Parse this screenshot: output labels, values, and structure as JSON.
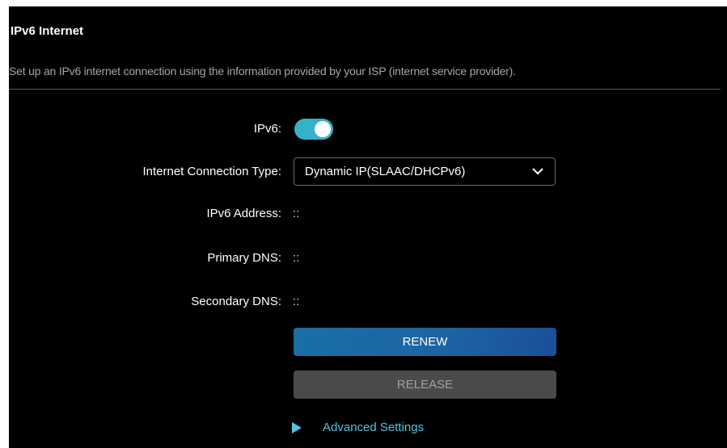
{
  "section": {
    "title": "IPv6 Internet",
    "description": "Set up an IPv6 internet connection using the information provided by your ISP (internet service provider)."
  },
  "fields": {
    "ipv6_label": "IPv6:",
    "ipv6_enabled": true,
    "connection_type_label": "Internet Connection Type:",
    "connection_type_value": "Dynamic IP(SLAAC/DHCPv6)",
    "ipv6_address_label": "IPv6 Address:",
    "ipv6_address_value": "::",
    "primary_dns_label": "Primary DNS:",
    "primary_dns_value": "::",
    "secondary_dns_label": "Secondary DNS:",
    "secondary_dns_value": "::"
  },
  "buttons": {
    "renew": "RENEW",
    "release": "RELEASE"
  },
  "advanced": {
    "label": "Advanced Settings"
  },
  "icons": {
    "toggle": "toggle-switch-on",
    "dropdown": "chevron-down-icon",
    "expand": "triangle-right-icon"
  },
  "colors": {
    "background": "#000000",
    "accent": "#37b1c9",
    "link": "#4fc3e0",
    "renew_button": "#1c63a2",
    "release_button": "#4a4a4a"
  }
}
